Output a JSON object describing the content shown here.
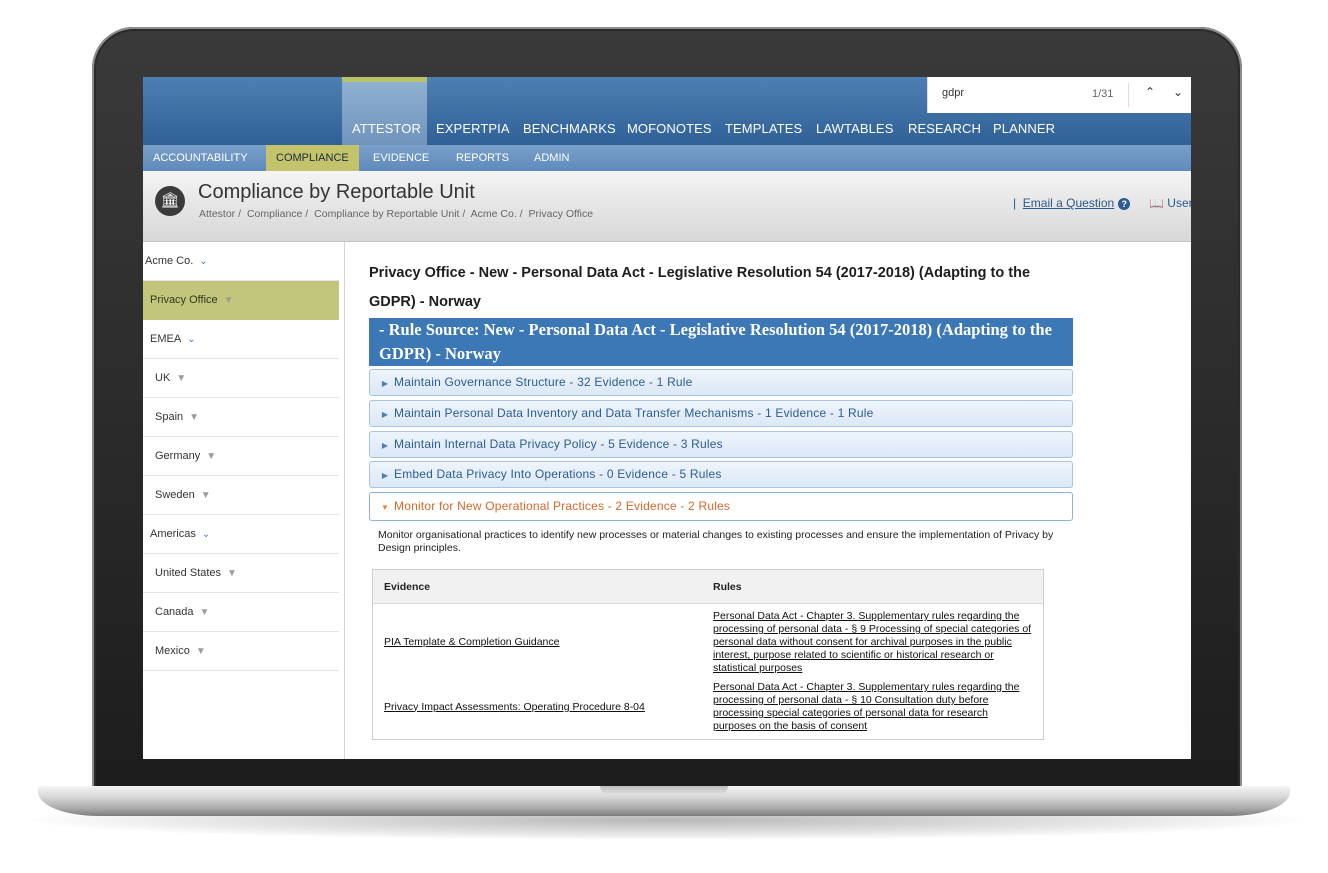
{
  "search": {
    "value": "gdpr",
    "match_count": "1/31"
  },
  "top_nav": {
    "active": "ATTESTOR",
    "tabs": [
      "ATTESTOR",
      "EXPERTPIA",
      "BENCHMARKS",
      "MOFONOTES",
      "TEMPLATES",
      "LAWTABLES",
      "RESEARCH",
      "PLANNER"
    ]
  },
  "sub_nav": {
    "active": "COMPLIANCE",
    "items": [
      "ACCOUNTABILITY",
      "COMPLIANCE",
      "EVIDENCE",
      "REPORTS",
      "ADMIN"
    ]
  },
  "page_header": {
    "title": "Compliance by Reportable Unit",
    "breadcrumb": [
      "Attestor /",
      "Compliance /",
      "Compliance by Reportable Unit /",
      "Acme Co. /",
      "Privacy Office"
    ],
    "email_link": "Email a Question",
    "guide_link": "User"
  },
  "sidebar": {
    "items": [
      {
        "label": "Acme Co.",
        "indent": false,
        "expandable": true,
        "filter": false,
        "active": false
      },
      {
        "label": "Privacy Office",
        "indent": true,
        "expandable": false,
        "filter": true,
        "active": true
      },
      {
        "label": "EMEA",
        "indent": true,
        "expandable": true,
        "filter": false,
        "active": false
      },
      {
        "label": "UK",
        "indent": true,
        "expandable": false,
        "filter": true,
        "active": false
      },
      {
        "label": "Spain",
        "indent": true,
        "expandable": false,
        "filter": true,
        "active": false
      },
      {
        "label": "Germany",
        "indent": true,
        "expandable": false,
        "filter": true,
        "active": false
      },
      {
        "label": "Sweden",
        "indent": true,
        "expandable": false,
        "filter": true,
        "active": false
      },
      {
        "label": "Americas",
        "indent": true,
        "expandable": true,
        "filter": false,
        "active": false
      },
      {
        "label": "United States",
        "indent": true,
        "expandable": false,
        "filter": true,
        "active": false
      },
      {
        "label": "Canada",
        "indent": true,
        "expandable": false,
        "filter": true,
        "active": false
      },
      {
        "label": "Mexico",
        "indent": true,
        "expandable": false,
        "filter": true,
        "active": false
      }
    ]
  },
  "content": {
    "title": "Privacy Office - New - Personal Data Act - Legislative Resolution 54 (2017-2018) (Adapting to the GDPR) - Norway",
    "rule_source": "- Rule Source: New - Personal Data Act - Legislative Resolution 54 (2017-2018) (Adapting to the GDPR) - Norway",
    "sections": [
      {
        "label": "Maintain Governance Structure - 32 Evidence - 1 Rule",
        "open": false
      },
      {
        "label": "Maintain Personal Data Inventory and Data Transfer Mechanisms - 1 Evidence - 1 Rule",
        "open": false
      },
      {
        "label": "Maintain Internal Data Privacy Policy - 5 Evidence - 3 Rules",
        "open": false
      },
      {
        "label": "Embed Data Privacy Into Operations - 0 Evidence - 5 Rules",
        "open": false
      },
      {
        "label": "Monitor for New Operational Practices - 2 Evidence - 2 Rules",
        "open": true
      }
    ],
    "section_description": "Monitor organisational practices to identify new processes or material changes to existing processes and ensure the implementation of Privacy by Design principles.",
    "table": {
      "headers": [
        "Evidence",
        "Rules"
      ],
      "rows": [
        {
          "evidence": "PIA Template & Completion Guidance",
          "rule": "Personal Data Act - Chapter 3. Supplementary rules regarding the processing of personal data - § 9 Processing of special categories of personal data without consent for archival purposes in the public interest, purpose related to scientific or historical research or statistical purposes"
        },
        {
          "evidence": "Privacy Impact Assessments: Operating Procedure 8-04",
          "rule": "Personal Data Act - Chapter 3. Supplementary rules regarding the processing of personal data - § 10 Consultation duty before processing special categories of personal data for research purposes on the basis of consent"
        }
      ]
    }
  },
  "colors": {
    "nav_blue": "#2f6197",
    "active_green": "#c2c36a",
    "rule_source_blue": "#3c78b5",
    "open_section_orange": "#d4682a"
  },
  "icons": {
    "logo": "institution-icon",
    "expand": "chevron-down-icon",
    "filter": "filter-icon",
    "search_prev": "chevron-up-icon",
    "search_next": "chevron-down-icon",
    "help": "question-circle-icon",
    "guide": "book-icon"
  }
}
